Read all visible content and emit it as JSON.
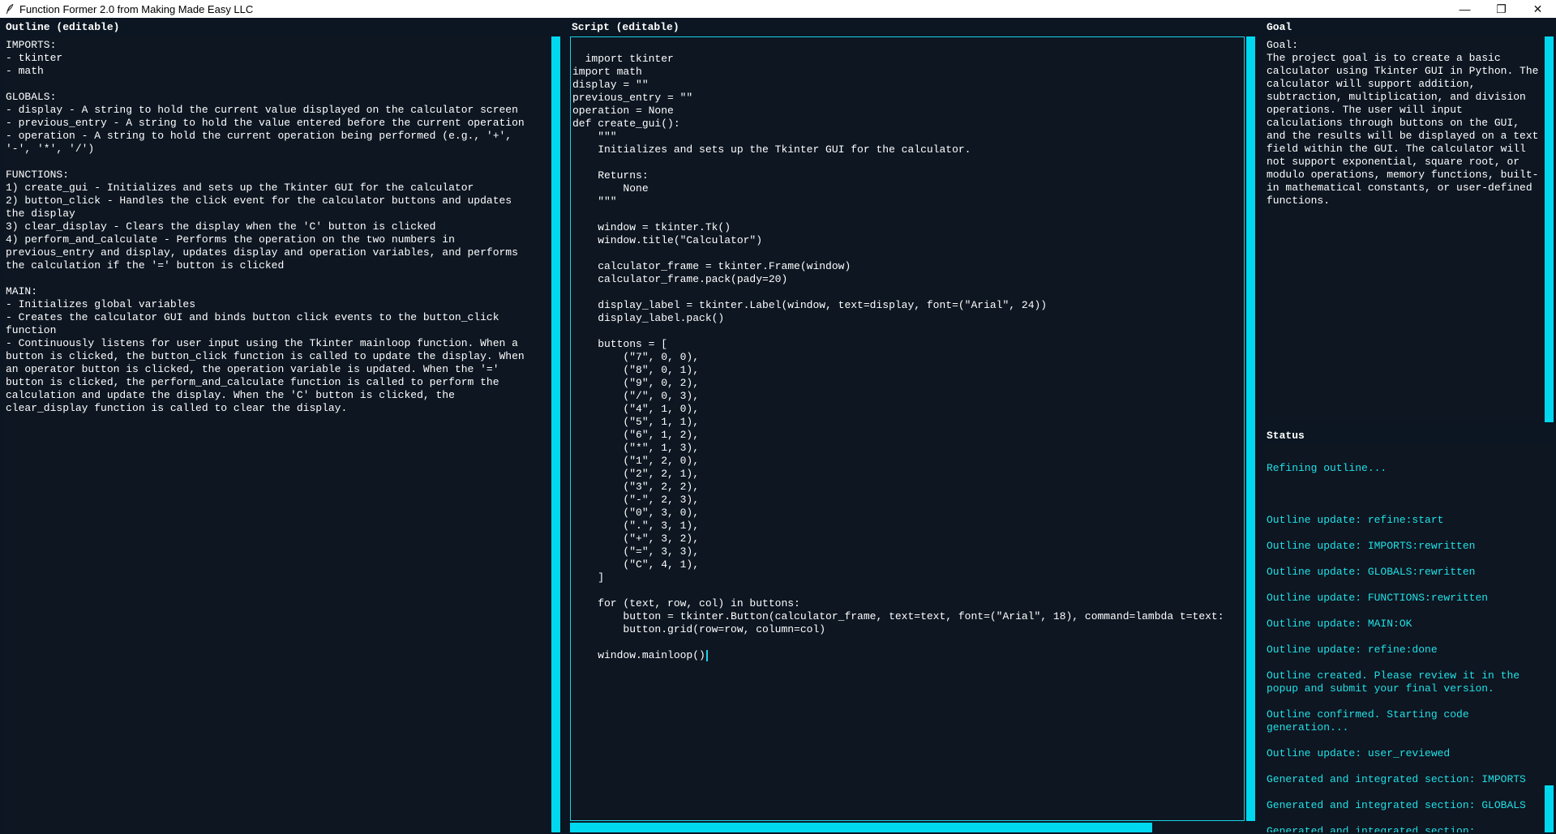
{
  "window": {
    "title": "Function Former 2.0 from Making Made Easy LLC",
    "controls": {
      "minimize": "—",
      "maximize": "❐",
      "close": "✕"
    }
  },
  "outline": {
    "label": "Outline (editable)",
    "text": "IMPORTS:\n- tkinter\n- math\n\nGLOBALS:\n- display - A string to hold the current value displayed on the calculator screen\n- previous_entry - A string to hold the value entered before the current operation\n- operation - A string to hold the current operation being performed (e.g., '+',\n'-', '*', '/')\n\nFUNCTIONS:\n1) create_gui - Initializes and sets up the Tkinter GUI for the calculator\n2) button_click - Handles the click event for the calculator buttons and updates\nthe display\n3) clear_display - Clears the display when the 'C' button is clicked\n4) perform_and_calculate - Performs the operation on the two numbers in\nprevious_entry and display, updates display and operation variables, and performs\nthe calculation if the '=' button is clicked\n\nMAIN:\n- Initializes global variables\n- Creates the calculator GUI and binds button click events to the button_click\nfunction\n- Continuously listens for user input using the Tkinter mainloop function. When a\nbutton is clicked, the button_click function is called to update the display. When\nan operator button is clicked, the operation variable is updated. When the '='\nbutton is clicked, the perform_and_calculate function is called to perform the\ncalculation and update the display. When the 'C' button is clicked, the\nclear_display function is called to clear the display."
  },
  "script": {
    "label": "Script (editable)",
    "text": "import tkinter\nimport math\ndisplay = \"\"\nprevious_entry = \"\"\noperation = None\ndef create_gui():\n    \"\"\"\n    Initializes and sets up the Tkinter GUI for the calculator.\n\n    Returns:\n        None\n    \"\"\"\n\n    window = tkinter.Tk()\n    window.title(\"Calculator\")\n\n    calculator_frame = tkinter.Frame(window)\n    calculator_frame.pack(pady=20)\n\n    display_label = tkinter.Label(window, text=display, font=(\"Arial\", 24))\n    display_label.pack()\n\n    buttons = [\n        (\"7\", 0, 0),\n        (\"8\", 0, 1),\n        (\"9\", 0, 2),\n        (\"/\", 0, 3),\n        (\"4\", 1, 0),\n        (\"5\", 1, 1),\n        (\"6\", 1, 2),\n        (\"*\", 1, 3),\n        (\"1\", 2, 0),\n        (\"2\", 2, 1),\n        (\"3\", 2, 2),\n        (\"-\", 2, 3),\n        (\"0\", 3, 0),\n        (\".\", 3, 1),\n        (\"+\", 3, 2),\n        (\"=\", 3, 3),\n        (\"C\", 4, 1),\n    ]\n\n    for (text, row, col) in buttons:\n        button = tkinter.Button(calculator_frame, text=text, font=(\"Arial\", 18), command=lambda t=text: \n        button.grid(row=row, column=col)\n\n    window.mainloop()"
  },
  "goal": {
    "label": "Goal",
    "text": "Goal:\nThe project goal is to create a basic calculator using Tkinter GUI in Python. The calculator will support addition, subtraction, multiplication, and division operations. The user will input calculations through buttons on the GUI, and the results will be displayed on a text field within the GUI. The calculator will not support exponential, square root, or modulo operations, memory functions, built-in mathematical constants, or user-defined functions."
  },
  "status": {
    "label": "Status",
    "partial_top": "Refining outline...",
    "lines": [
      "Outline update: refine:start",
      "Outline update: IMPORTS:rewritten",
      "Outline update: GLOBALS:rewritten",
      "Outline update: FUNCTIONS:rewritten",
      "Outline update: MAIN:OK",
      "Outline update: refine:done",
      "Outline created. Please review it in the popup and submit your final version.",
      "Outline confirmed. Starting code generation...",
      "Outline update: user_reviewed",
      "Generated and integrated section: IMPORTS",
      "Generated and integrated section: GLOBALS",
      "Generated and integrated section: create_gui"
    ]
  },
  "colors": {
    "background": "#0b1622",
    "text": "#ffffff",
    "status_text": "#22e0e6",
    "scrollbar": "#00d8f0"
  }
}
